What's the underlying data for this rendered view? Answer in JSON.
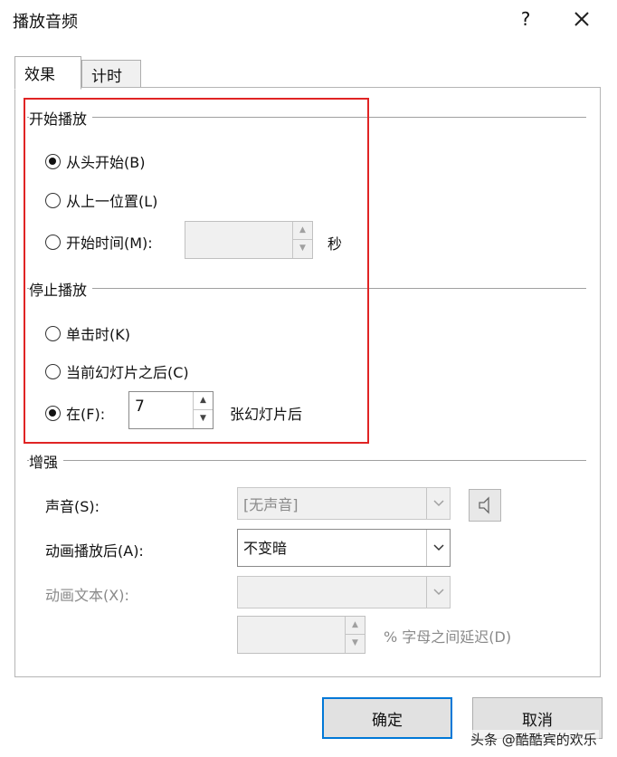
{
  "window": {
    "title": "播放音频",
    "help": "?"
  },
  "tabs": [
    {
      "label": "效果",
      "active": true
    },
    {
      "label": "计时",
      "active": false
    }
  ],
  "start": {
    "group_label": "开始播放",
    "options": [
      {
        "label": "从头开始(B)",
        "checked": true
      },
      {
        "label": "从上一位置(L)",
        "checked": false
      },
      {
        "label": "开始时间(M):",
        "checked": false
      }
    ],
    "time_value": "",
    "time_unit": "秒"
  },
  "stop": {
    "group_label": "停止播放",
    "options": [
      {
        "label": "单击时(K)",
        "checked": false
      },
      {
        "label": "当前幻灯片之后(C)",
        "checked": false
      },
      {
        "label": "在(F):",
        "checked": true
      }
    ],
    "slides_value": "7",
    "slides_suffix": "张幻灯片后"
  },
  "enhance": {
    "group_label": "增强",
    "sound_label": "声音(S):",
    "sound_value": "[无声音]",
    "after_anim_label": "动画播放后(A):",
    "after_anim_value": "不变暗",
    "anim_text_label": "动画文本(X):",
    "anim_text_value": "",
    "delay_value": "",
    "delay_suffix": "% 字母之间延迟(D)"
  },
  "buttons": {
    "ok": "确定",
    "cancel": "取消"
  },
  "watermark": "头条 @酷酷宾的欢乐",
  "colors": {
    "highlight": "#e02424",
    "ok_border": "#0078d7"
  }
}
